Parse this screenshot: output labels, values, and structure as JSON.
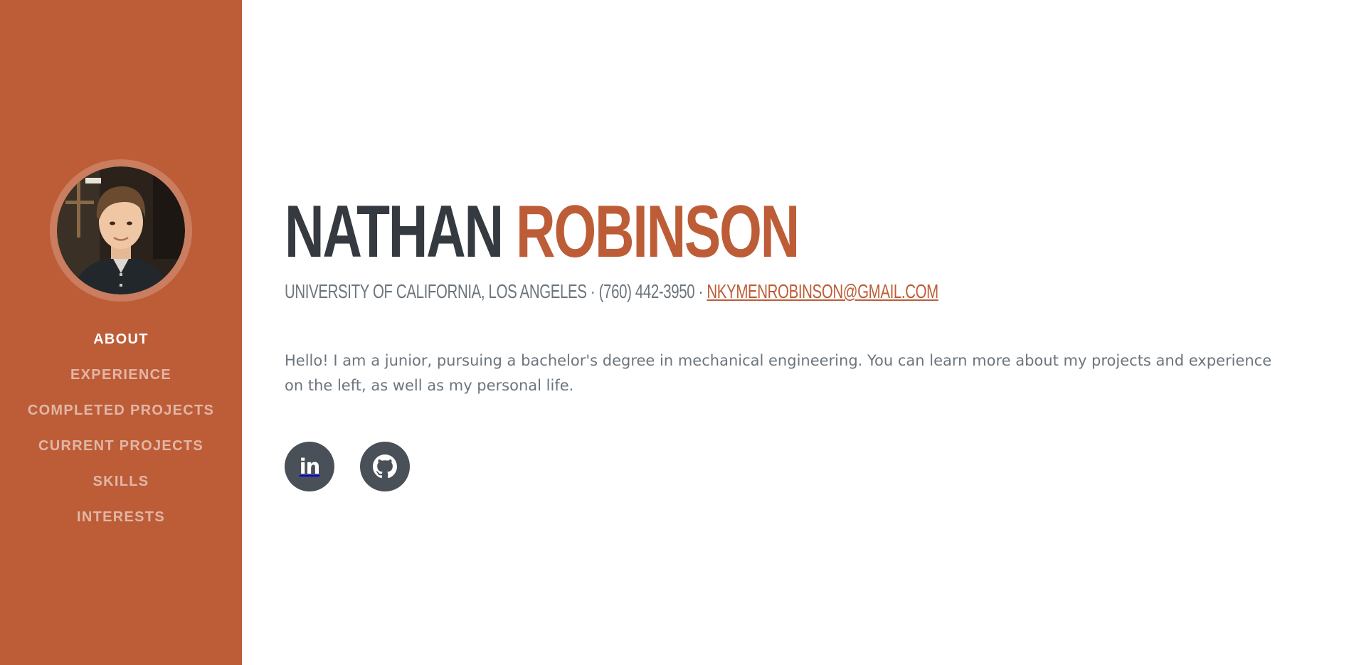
{
  "sidebar": {
    "avatar_alt": "Profile photo",
    "nav": [
      {
        "label": "About",
        "active": true
      },
      {
        "label": "Experience"
      },
      {
        "label": "Completed Projects"
      },
      {
        "label": "Current Projects"
      },
      {
        "label": "Skills"
      },
      {
        "label": "Interests"
      }
    ]
  },
  "about": {
    "first_name": "NATHAN",
    "last_name": "ROBINSON",
    "school": "University of California, Los Angeles",
    "separator1": " · ",
    "phone": "(760) 442-3950",
    "separator2": " · ",
    "email": "nkymenrobinson@gmail.com",
    "intro": "Hello! I am a junior, pursuing a bachelor's degree in mechanical engineering. You can learn more about my projects and experience on the left, as well as my personal life."
  },
  "social": [
    {
      "icon": "linkedin-icon"
    },
    {
      "icon": "github-icon"
    }
  ],
  "colors": {
    "primary": "#bd5d38",
    "heading": "#343a40",
    "muted": "#6c757d",
    "social_bg": "#495057"
  }
}
